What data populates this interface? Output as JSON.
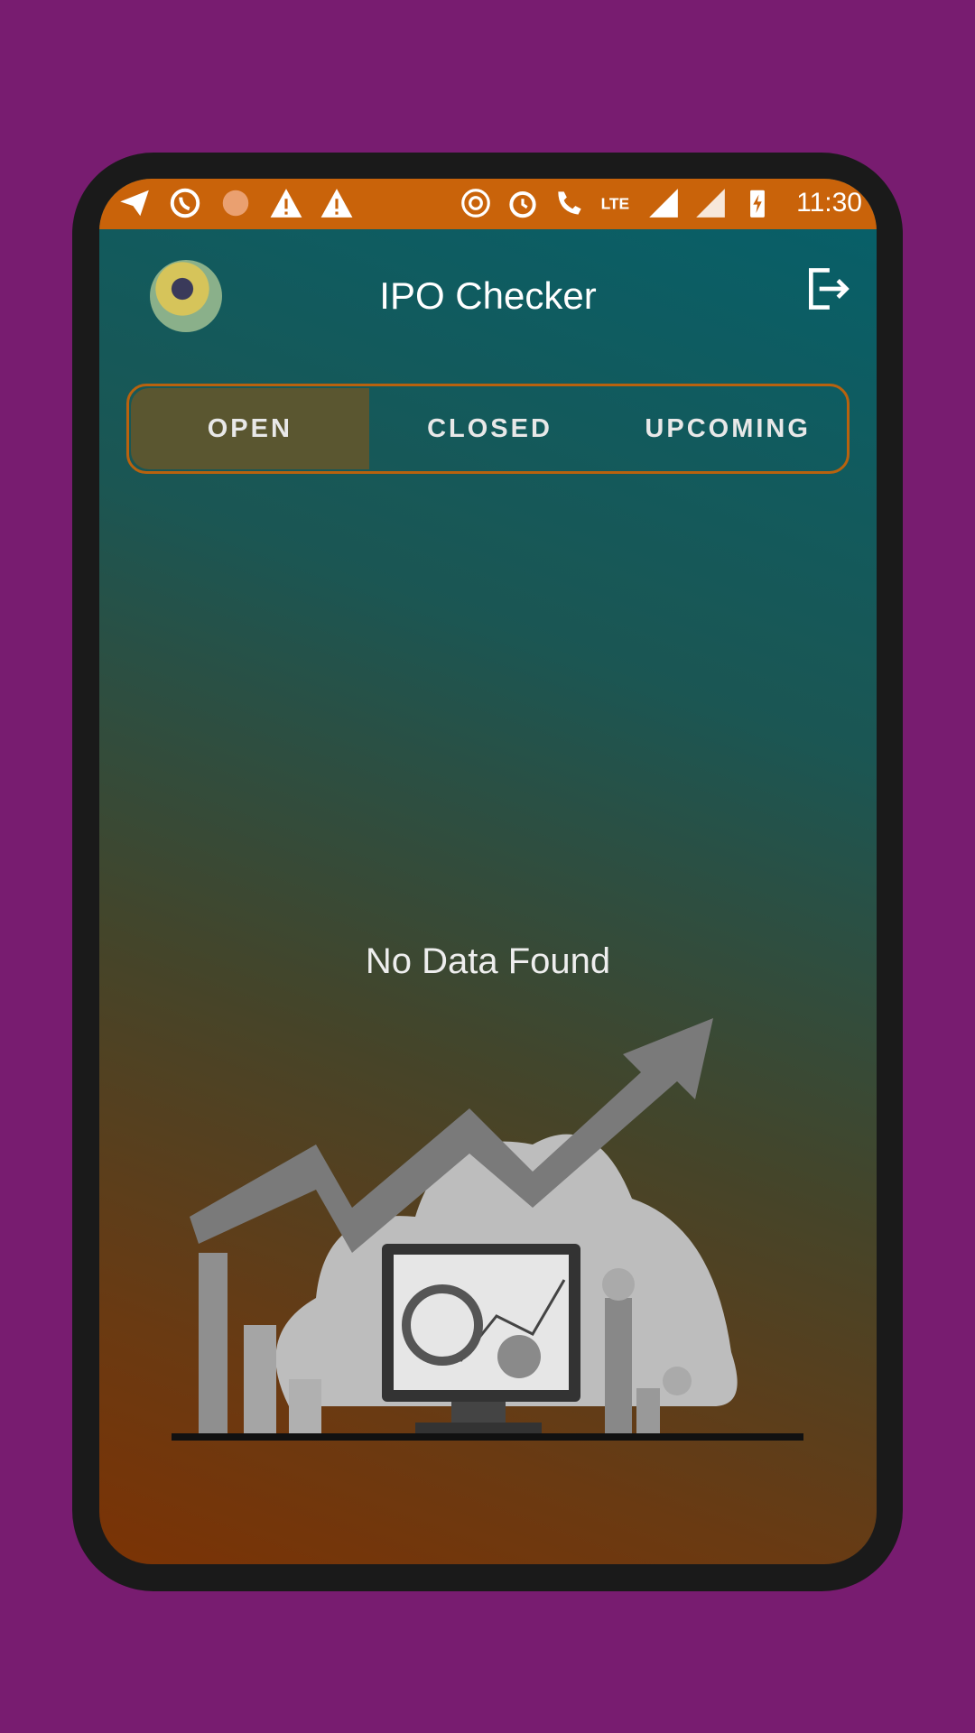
{
  "status_bar": {
    "time": "11:30",
    "left_icons": [
      "telegram-icon",
      "whatsapp-icon",
      "circle-icon",
      "warning-icon",
      "warning-icon"
    ],
    "right_icons": [
      "hotspot-icon",
      "alarm-icon",
      "volte-call-icon",
      "lte-icon",
      "signal-icon",
      "signal-icon",
      "battery-charging-icon"
    ]
  },
  "header": {
    "title": "IPO Checker",
    "avatar": "profile-photo",
    "action_icon": "logout-icon"
  },
  "tabs": [
    {
      "label": "OPEN",
      "active": true
    },
    {
      "label": "CLOSED",
      "active": false
    },
    {
      "label": "UPCOMING",
      "active": false
    }
  ],
  "empty_state": {
    "message": "No Data Found",
    "illustration": "growth-chart-illustration"
  },
  "colors": {
    "background": "#781c70",
    "status_bar": "#c9630a",
    "tab_border": "#b8620e",
    "gradient_top": "#06606a",
    "gradient_bottom": "#7b3305"
  }
}
